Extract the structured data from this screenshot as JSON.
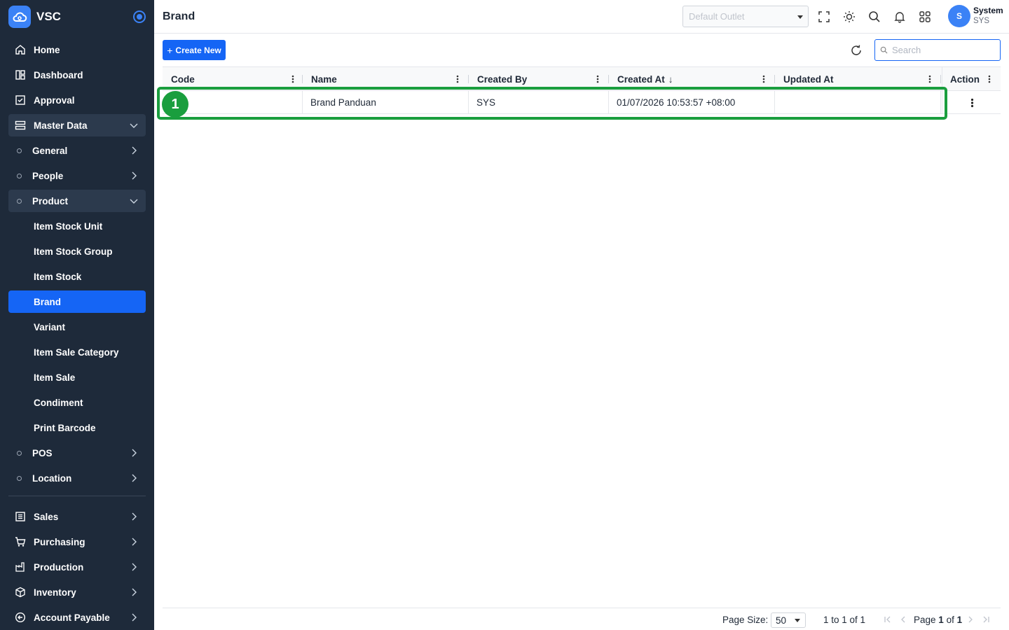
{
  "app": {
    "name": "VSC"
  },
  "sidebar": {
    "items": [
      {
        "label": "Home",
        "icon": "home-icon"
      },
      {
        "label": "Dashboard",
        "icon": "dashboard-icon"
      },
      {
        "label": "Approval",
        "icon": "approval-icon"
      },
      {
        "label": "Master Data",
        "icon": "master-data-icon",
        "expanded": true
      },
      {
        "label": "General"
      },
      {
        "label": "People"
      },
      {
        "label": "Product",
        "expanded": true
      },
      {
        "label": "Item Stock Unit"
      },
      {
        "label": "Item Stock Group"
      },
      {
        "label": "Item Stock"
      },
      {
        "label": "Brand",
        "active": true
      },
      {
        "label": "Variant"
      },
      {
        "label": "Item Sale Category"
      },
      {
        "label": "Item Sale"
      },
      {
        "label": "Condiment"
      },
      {
        "label": "Print Barcode"
      },
      {
        "label": "POS"
      },
      {
        "label": "Location"
      },
      {
        "label": "Sales",
        "icon": "sales-icon"
      },
      {
        "label": "Purchasing",
        "icon": "cart-icon"
      },
      {
        "label": "Production",
        "icon": "factory-icon"
      },
      {
        "label": "Inventory",
        "icon": "box-icon"
      },
      {
        "label": "Account Payable",
        "icon": "account-payable-icon"
      }
    ]
  },
  "header": {
    "title": "Brand",
    "outlet_placeholder": "Default Outlet",
    "user": {
      "initial": "S",
      "name": "System",
      "code": "SYS"
    }
  },
  "toolbar": {
    "create_label": "Create New",
    "create_plus": "+",
    "search_placeholder": "Search"
  },
  "grid": {
    "columns": [
      "Code",
      "Name",
      "Created By",
      "Created At",
      "Updated At",
      "Action"
    ],
    "sort_indicator": "↓",
    "rows": [
      {
        "code": "",
        "name": "Brand Panduan",
        "created_by": "SYS",
        "created_at": "01/07/2026 10:53:57 +08:00",
        "updated_at": ""
      }
    ]
  },
  "annotation": {
    "marker": "1",
    "color": "#1a9e3e"
  },
  "footer": {
    "page_size_label": "Page Size:",
    "page_size": "50",
    "range_text": "1 to 1 of 1",
    "page_prefix": "Page",
    "page_current": "1",
    "page_of": "of",
    "page_total": "1"
  },
  "colors": {
    "sidebar": "#1e2a3a",
    "accent": "#1565f5"
  }
}
